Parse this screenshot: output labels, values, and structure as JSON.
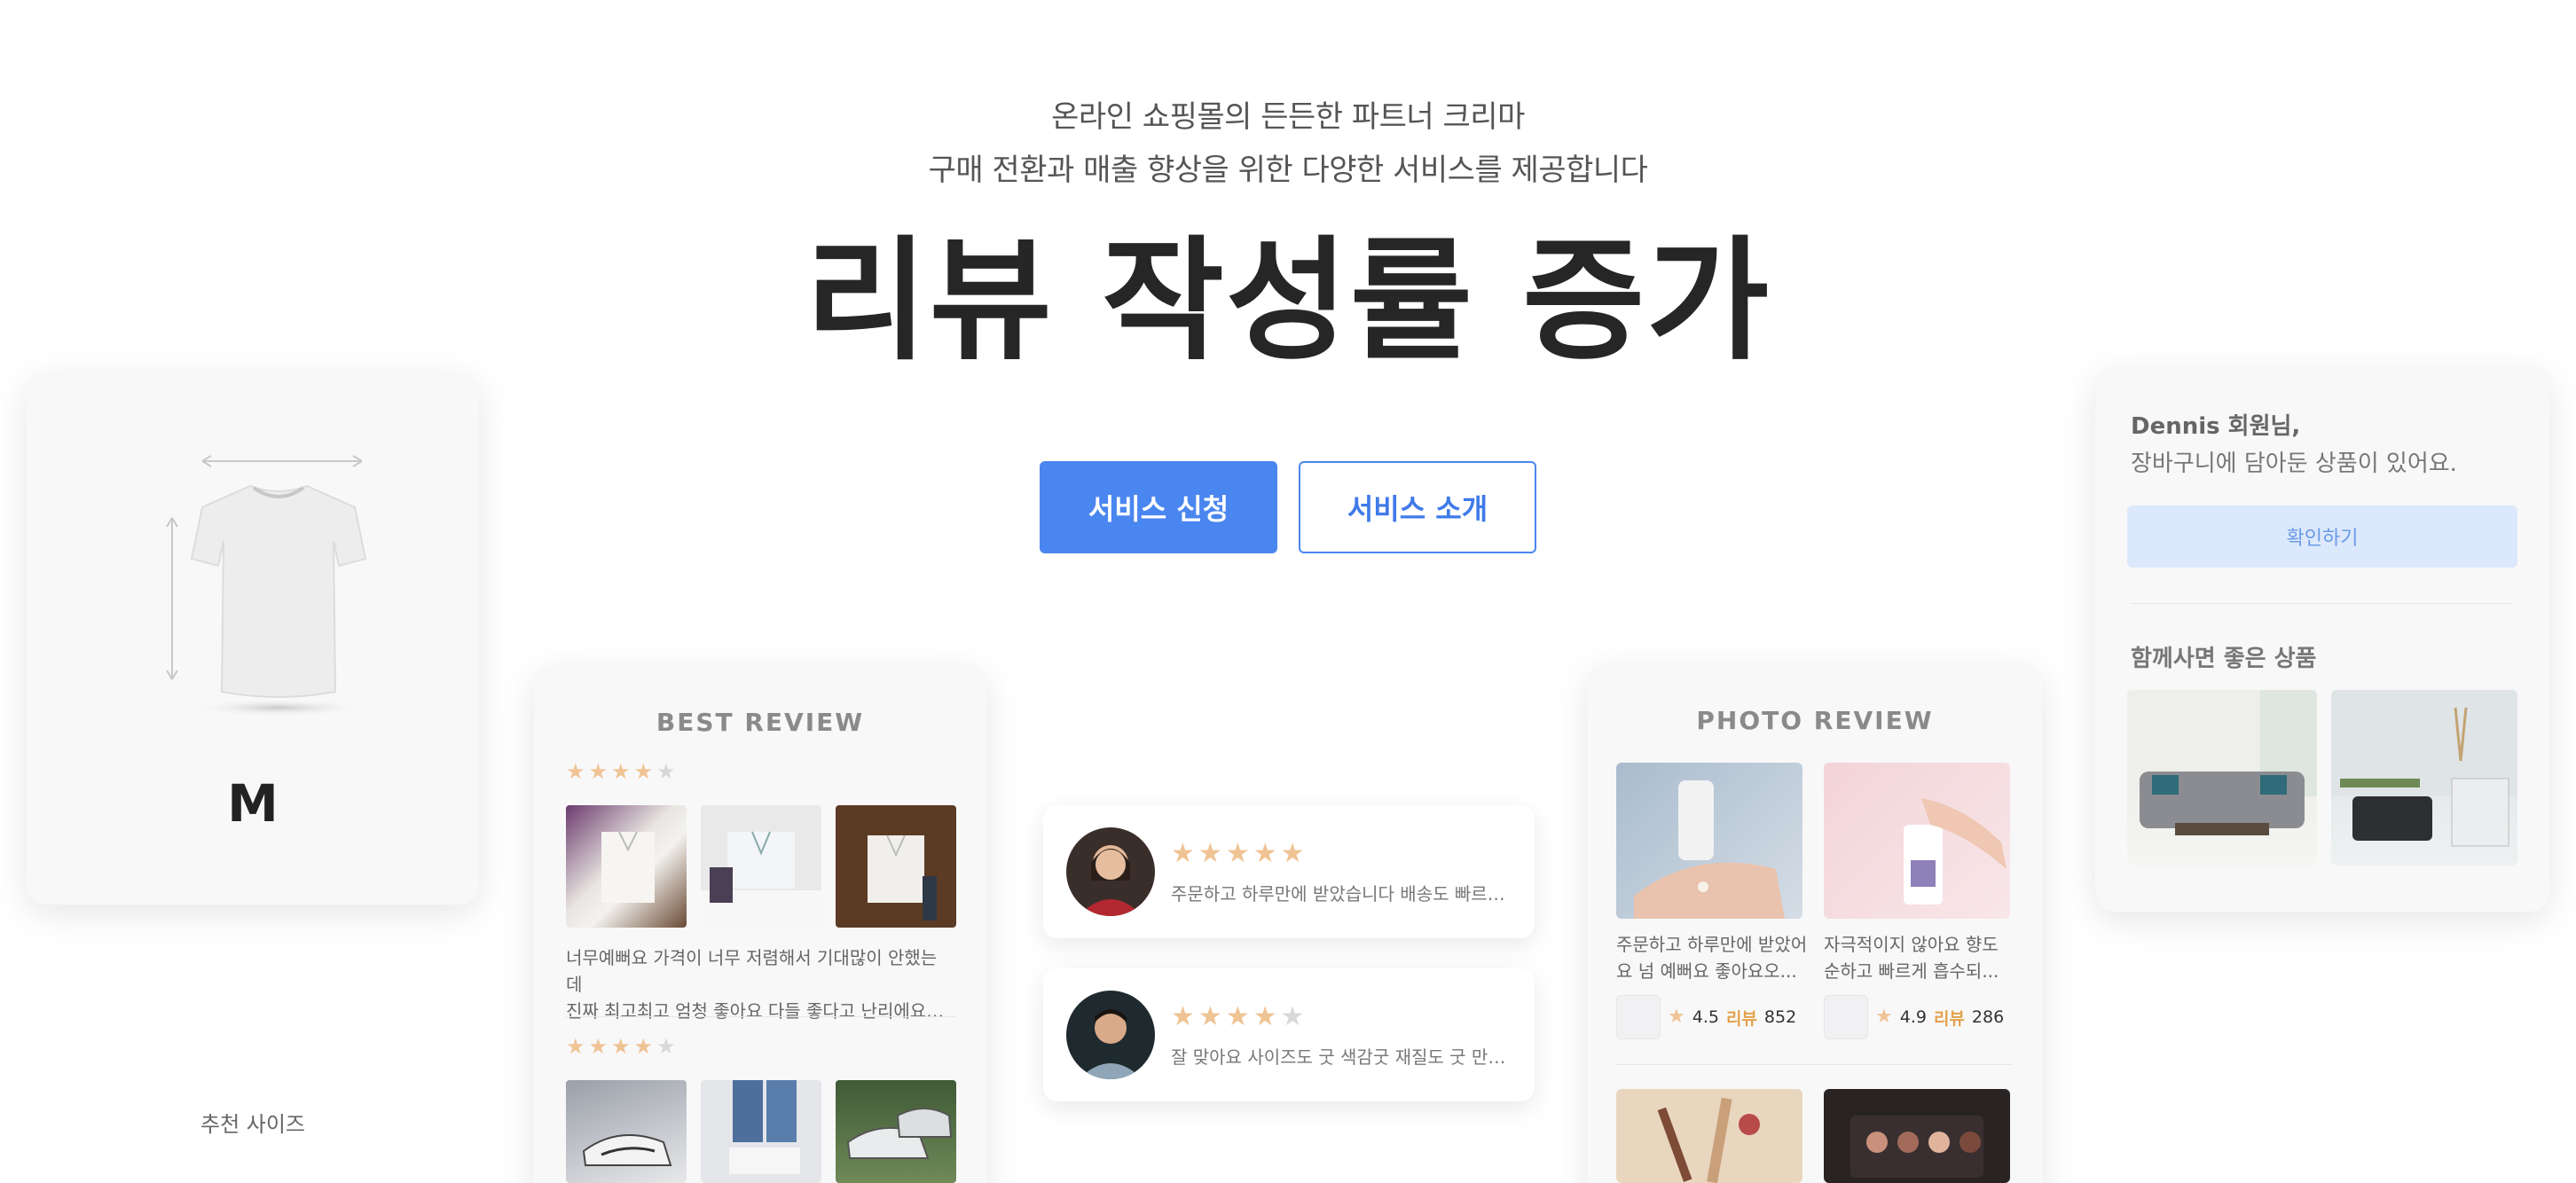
{
  "hero": {
    "subtitle_line1": "온라인 쇼핑몰의 든든한 파트너 크리마",
    "subtitle_line2": "구매 전환과 매출 향상을 위한 다양한 서비스를 제공합니다",
    "headline": "리뷰 작성률 증가"
  },
  "buttons": {
    "apply": "서비스 신청",
    "intro": "서비스 소개"
  },
  "size_card": {
    "label": "추천 사이즈",
    "size": "M"
  },
  "best_review": {
    "title": "BEST REVIEW",
    "reviews": [
      {
        "rating": 4,
        "max": 5,
        "text_line1": "너무예뻐요 가격이 너무 저렴해서 기대많이 안했는 데",
        "text_line2": "진짜 최고최고 엄청 좋아요 다들 좋다고 난리에요…"
      },
      {
        "rating": 4,
        "max": 5
      }
    ]
  },
  "review_pills": [
    {
      "rating": 5,
      "max": 5,
      "text": "주문하고 하루만에 받았습니다 배송도 빠르고..."
    },
    {
      "rating": 4,
      "max": 5,
      "text": "잘 맞아요 사이즈도 굿 색감굿 재질도 굿 만족..."
    }
  ],
  "photo_review": {
    "title": "PHOTO REVIEW",
    "items": [
      {
        "text_line1": "주문하고 하루만에 받았어",
        "text_line2": "요 넘 예뻐요 좋아요오...",
        "rating": "4.5",
        "review_label": "리뷰",
        "review_count": "852"
      },
      {
        "text_line1": "자극적이지 않아요 향도",
        "text_line2": "순하고 빠르게 흡수되...",
        "rating": "4.9",
        "review_label": "리뷰",
        "review_count": "286"
      }
    ]
  },
  "cart_card": {
    "greeting": "Dennis 회원님,",
    "message": "장바구니에 담아둔 상품이 있어요.",
    "confirm": "확인하기",
    "together": "함께사면 좋은 상품"
  },
  "colors": {
    "primary": "#4a86f0",
    "star": "#f0c394",
    "review_accent": "#e3a24b"
  }
}
